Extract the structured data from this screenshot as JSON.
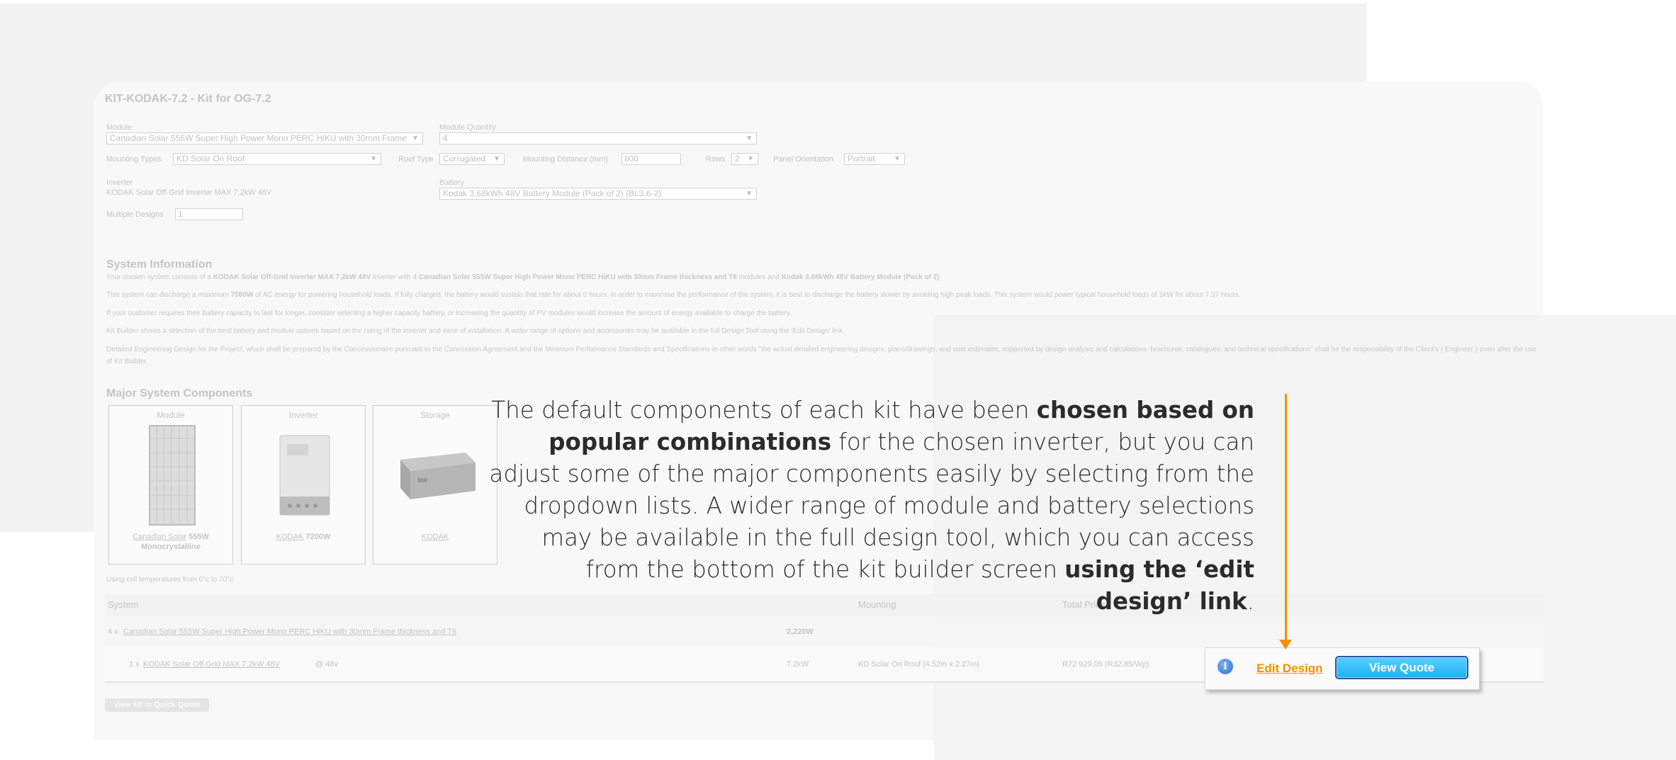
{
  "kit": {
    "title": "KIT-KODAK-7.2 - Kit for OG-7.2",
    "module_label": "Module",
    "module_value": "Canadian Solar 555W Super High Power Mono PERC HiKU with 30mm Frame",
    "module_qty_label": "Module Quantity",
    "module_qty_value": "4",
    "mounting_types_label": "Mounting Types",
    "mounting_types_value": "KD Solar On Roof",
    "roof_type_label": "Roof Type",
    "roof_type_value": "Corrugated",
    "mounting_distance_label": "Mounting Distance (mm)",
    "mounting_distance_value": "800",
    "rows_label": "Rows",
    "rows_value": "2",
    "panel_orientation_label": "Panel Orientation",
    "panel_orientation_value": "Portrait",
    "inverter_label": "Inverter",
    "inverter_value": "KODAK Solar Off-Grid Inverter MAX 7.2kW 48V",
    "battery_label": "Battery",
    "battery_value": "Kodak 3.68kWh 48V Battery Module (Pack of 2) (BL3.6-2)",
    "multiple_designs_label": "Multiple Designs",
    "multiple_designs_value": "1"
  },
  "system_info": {
    "title": "System Information",
    "p1_a": "Your chosen system consists of a ",
    "p1_b": "KODAK Solar Off-Grid Inverter MAX 7.2kW 48V",
    "p1_c": " inverter with 4 ",
    "p1_d": "Canadian Solar 555W Super High Power Mono PERC HiKU with 30mm Frame thickness and T6",
    "p1_e": " modules and ",
    "p1_f": "Kodak 3.68kWh 48V Battery Module (Pack of 2)",
    "p1_g": ".",
    "p2_a": "This system can discharge a maximum ",
    "p2_b": "7560W",
    "p2_c": " of AC energy for powering household loads. If fully charged, the battery would sustain that rate for about 0 hours. In order to maximise the performance of the system, it is best to discharge the battery slower by avoiding high peak loads. This system would power typical household loads of 1kW for about 7.37 hours.",
    "p3": "If your customer requires their battery capacity to last for longer, consider selecting a higher capacity battery, or increasing the quantity of PV modules would increase the amount of energy available to charge the battery.",
    "p4": "Kit Builder shows a selection of the best battery and module options based on the rating of the inverter and ease of installation. A wider range of options and accessories may be available in the full Design Tool using the 'Edit Design' link.",
    "p5": "Detailed Engineering Design for the Project, which shall be prepared by the Concessionaire pursuant to the Concession Agreement and the Minimum Performance Standards and Specifications in other words \"the actual detailed engineering designs, plans/drawings, and cost estimates, supported by design analysis and calculations, brochures, catalogues, and technical specifications\" shall be the responsibility of the Client's ( Engineer ) even after the use of Kit Builder."
  },
  "components": {
    "title": "Major System Components",
    "module": {
      "title": "Module",
      "brand": "Canadian Solar",
      "spec": "555W",
      "type": "Monocrystalline"
    },
    "inverter": {
      "title": "Inverter",
      "brand": "KODAK",
      "spec": "7200W"
    },
    "storage": {
      "title": "Storage",
      "brand": "KODAK"
    }
  },
  "temp_note": "Using cell temperatures from 0°c to 70°c",
  "table": {
    "col_system": "System",
    "col_mounting": "Mounting",
    "col_total": "Total Price",
    "row1_qty": "4 x",
    "row1_name": "Canadian Solar 555W Super High Power Mono PERC HiKU with 30mm Frame thickness and T6",
    "row1_power": "2,220W",
    "row2_qty": "1 x",
    "row2_name": "KODAK Solar Off-Grid MAX 7.2kW 48V",
    "row2_voltage": "@ 48v",
    "row2_power": "7.2kW",
    "row2_mounting": "KD Solar On Roof (4.52m x 2.27m)",
    "row2_price": "R72 929,05 (R32,85/Wp)"
  },
  "quick_quote_btn": "View kit in Quick Quote",
  "actions": {
    "info_glyph": "i",
    "edit_design": "Edit Design",
    "view_quote": "View Quote"
  },
  "annotation": {
    "t1": "The default components of each kit have been ",
    "t2": "chosen based on popular combinations",
    "t3": " for the chosen inverter, but you can adjust some of the major components easily by selecting from the dropdown lists. A wider range of module and battery selections may be available in the full design tool, which you can access from the bottom of the kit builder screen ",
    "t4": "using the ‘edit design’ link",
    "t5": "."
  },
  "colors": {
    "accent": "#f39200",
    "button_blue": "#1bb3f5",
    "button_border": "#2a56a6"
  }
}
